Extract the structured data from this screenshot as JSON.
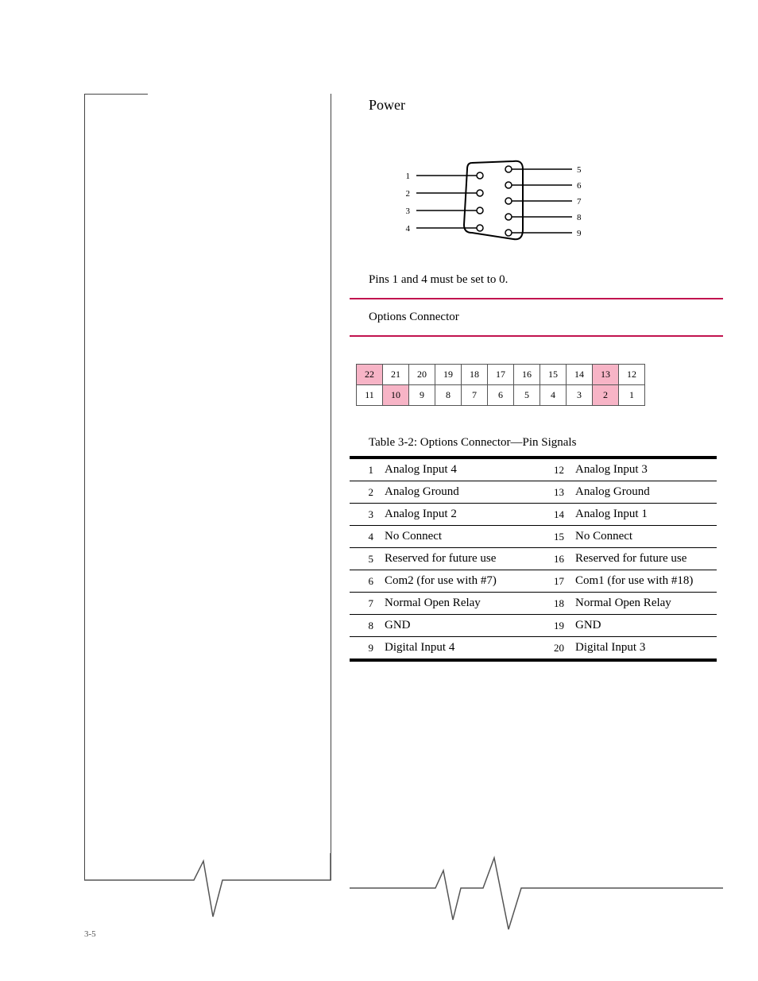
{
  "header": {
    "power": "Power"
  },
  "serial": {
    "pins": {
      "p1": "1",
      "p2": "2",
      "p3": "3",
      "p4": "4",
      "p5": "5",
      "p6": "6",
      "p7": "7",
      "p8": "8",
      "p9": "9"
    }
  },
  "notes": {
    "zero": "Pins 1 and 4 must be set to 0.",
    "options_title": "Options Connector",
    "table_title": "Table 3-2: Options Connector—Pin Signals"
  },
  "grid": {
    "top": [
      "22",
      "21",
      "20",
      "19",
      "18",
      "17",
      "16",
      "15",
      "14",
      "13",
      "12"
    ],
    "bottom": [
      "11",
      "10",
      "9",
      "8",
      "7",
      "6",
      "5",
      "4",
      "3",
      "2",
      "1"
    ],
    "hl_top": [
      1,
      0,
      0,
      0,
      0,
      0,
      0,
      0,
      0,
      1,
      0
    ],
    "hl_bottom": [
      0,
      1,
      0,
      0,
      0,
      0,
      0,
      0,
      0,
      1,
      0
    ]
  },
  "pinout": [
    {
      "n1": "1",
      "a": "Analog Input 4",
      "n2": "12",
      "b": "Analog Input 3"
    },
    {
      "n1": "2",
      "a": "Analog Ground",
      "n2": "13",
      "b": "Analog Ground"
    },
    {
      "n1": "3",
      "a": "Analog Input 2",
      "n2": "14",
      "b": "Analog Input 1"
    },
    {
      "n1": "4",
      "a": "No Connect",
      "n2": "15",
      "b": "No Connect"
    },
    {
      "n1": "5",
      "a": "Reserved for future use",
      "n2": "16",
      "b": "Reserved for future use"
    },
    {
      "n1": "6",
      "a": "Com2 (for use with #7)",
      "n2": "17",
      "b": "Com1 (for use with #18)"
    },
    {
      "n1": "7",
      "a": "Normal Open Relay",
      "n2": "18",
      "b": "Normal Open Relay"
    },
    {
      "n1": "8",
      "a": "GND",
      "n2": "19",
      "b": "GND"
    },
    {
      "n1": "9",
      "a": "Digital Input 4",
      "n2": "20",
      "b": "Digital Input 3"
    }
  ],
  "footer": {
    "page": "3-5"
  }
}
